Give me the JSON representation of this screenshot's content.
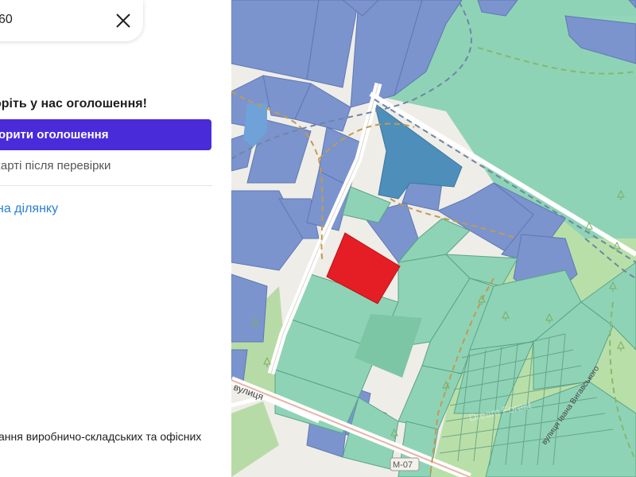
{
  "search": {
    "value": "60"
  },
  "promo": {
    "title": "оріть у нас оголошення!",
    "button_label": "орити оголошення",
    "note": "карті після перевірки"
  },
  "parcel_link": "на ділянку",
  "purpose": "ання виробничо-складських та офісних",
  "map": {
    "street_label_1": "вулиця",
    "street_label_2": "вулиця Івана Вигавського",
    "road_label": "М-07",
    "watermark": "Dream Forest",
    "colors": {
      "built_parcel": "#7b94ce",
      "agri_parcel": "#8fd3b6",
      "forest": "#b9dfa9",
      "selected_parcel": "#e51e26",
      "water_parcel": "#4d8fba"
    }
  }
}
